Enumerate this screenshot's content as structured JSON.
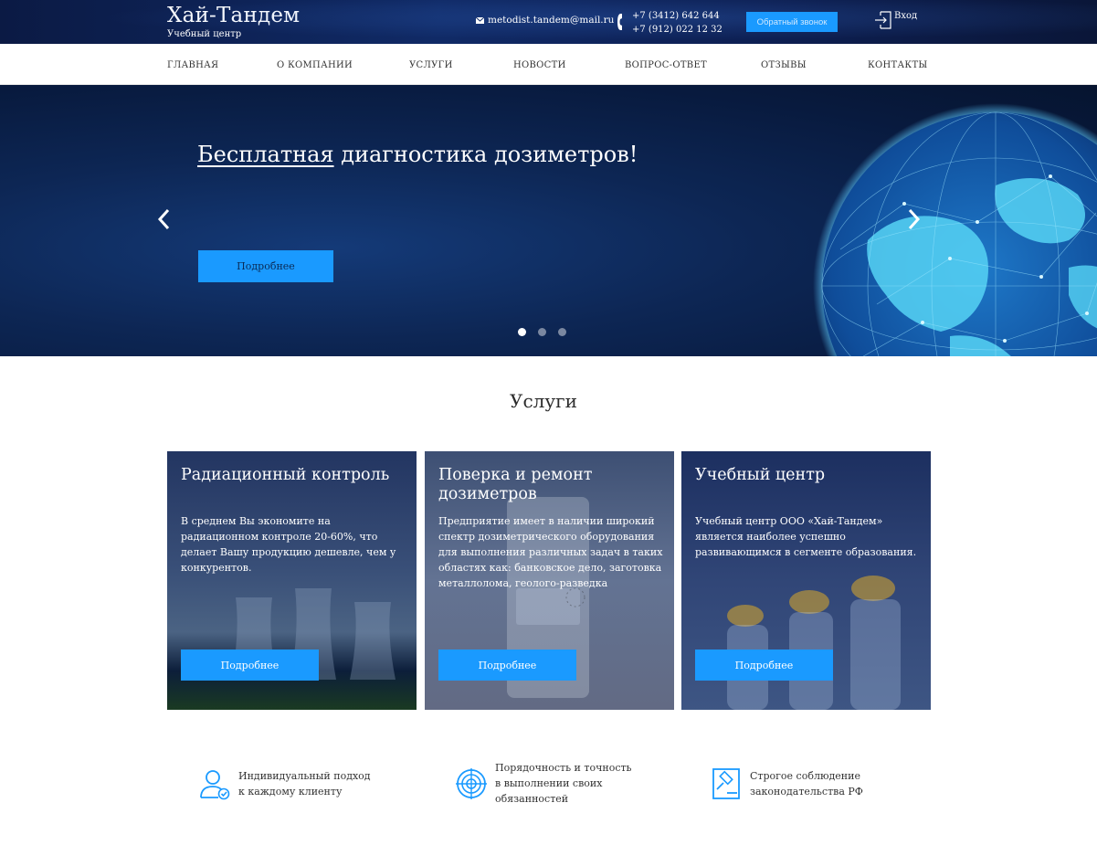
{
  "brand": {
    "title": "Хай-Тандем",
    "subtitle": "Учебный центр"
  },
  "contacts": {
    "email": "metodist.tandem@mail.ru",
    "phone1": "+7 (3412) 642 644",
    "phone2": "+7 (912) 022 12 32",
    "callback_label": "Обратный звонок",
    "login_label": "Вход"
  },
  "nav": {
    "items": [
      {
        "label": "ГЛАВНАЯ"
      },
      {
        "label": "О КОМПАНИИ"
      },
      {
        "label": "УСЛУГИ"
      },
      {
        "label": "НОВОСТИ"
      },
      {
        "label": "ВОПРОС-ОТВЕТ"
      },
      {
        "label": "ОТЗЫВЫ"
      },
      {
        "label": "КОНТАКТЫ"
      }
    ]
  },
  "hero": {
    "title_underlined": "Бесплатная",
    "title_rest": " диагностика дозиметров!",
    "button_label": "Подробнее",
    "slide_count": 3,
    "active_slide": 1
  },
  "services": {
    "title": "Услуги",
    "cards": [
      {
        "title": "Радиационный контроль",
        "text": "В среднем Вы экономите на радиационном контроле 20-60%, что делает Вашу продукцию дешевле, чем у конкурентов.",
        "button_label": "Подробнее"
      },
      {
        "title": "Поверка и ремонт дозиметров",
        "text": "Предприятие имеет в наличии широкий спектр дозиметрического оборудования для выполнения различных задач в таких областях как: банковское дело, заготовка металлолома, геолого-разведка",
        "button_label": "Подробнее"
      },
      {
        "title": "Учебный центр",
        "text": "Учебный центр ООО «Хай-Тандем» является наиболее успешно развивающимся в сегменте образования.",
        "button_label": "Подробнее"
      }
    ]
  },
  "features": [
    {
      "line1": "Индивидуальный подход",
      "line2": "к каждому клиенту",
      "line3": "",
      "icon": "user-check-icon"
    },
    {
      "line1": "Порядочность и точность",
      "line2": "в выполнении своих",
      "line3": "обязанностей",
      "icon": "target-icon"
    },
    {
      "line1": "Строгое соблюдение",
      "line2": "законодательства РФ",
      "line3": "",
      "icon": "gavel-icon"
    }
  ],
  "colors": {
    "accent": "#1a9aff",
    "header_bg": "#0d1f52"
  }
}
